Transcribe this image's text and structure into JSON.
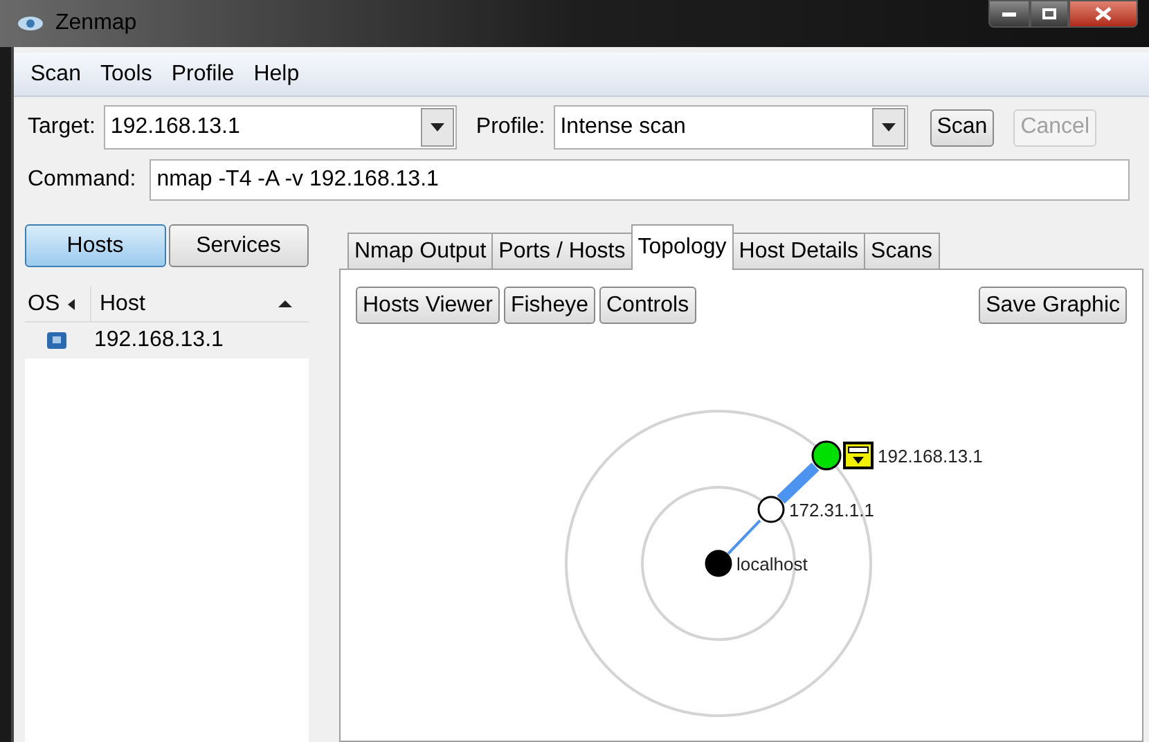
{
  "window": {
    "title": "Zenmap"
  },
  "menu": [
    "Scan",
    "Tools",
    "Profile",
    "Help"
  ],
  "target": {
    "label": "Target:",
    "value": "192.168.13.1"
  },
  "profile": {
    "label": "Profile:",
    "value": "Intense scan"
  },
  "buttons": [
    {
      "label": "Scan",
      "disabled": false
    },
    {
      "label": "Cancel",
      "disabled": true
    }
  ],
  "command": {
    "label": "Command:",
    "value": "nmap -T4 -A -v 192.168.13.1"
  },
  "view_toggle": [
    {
      "label": "Hosts",
      "selected": true
    },
    {
      "label": "Services",
      "selected": false
    }
  ],
  "host_list": {
    "columns": [
      "OS",
      "Host"
    ],
    "rows": [
      {
        "host": "192.168.13.1"
      }
    ]
  },
  "tabs": [
    {
      "label": "Nmap Output",
      "selected": false
    },
    {
      "label": "Ports / Hosts",
      "selected": false
    },
    {
      "label": "Topology",
      "selected": true
    },
    {
      "label": "Host Details",
      "selected": false
    },
    {
      "label": "Scans",
      "selected": false
    }
  ],
  "toolbar": [
    "Hosts Viewer",
    "Fisheye",
    "Controls"
  ],
  "save_button": "Save Graphic",
  "topology": {
    "nodes": [
      {
        "label": "localhost",
        "color": "#000000"
      },
      {
        "label": "172.31.1.1",
        "color": "#ffffff"
      },
      {
        "label": "192.168.13.1",
        "color": "#00e000",
        "firewall": true
      }
    ]
  }
}
